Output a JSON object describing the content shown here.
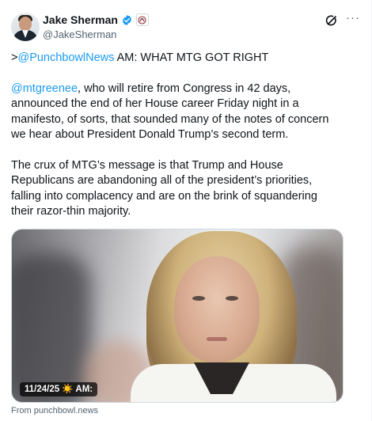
{
  "author": {
    "display_name": "Jake Sherman",
    "handle": "@JakeSherman",
    "verified_icon": "verified-badge-icon",
    "affiliation_icon": "affiliation-icon"
  },
  "actions": {
    "grok_icon": "grok-icon",
    "more_label": "···"
  },
  "tweet": {
    "line1_prefix": ">",
    "line1_link": "@PunchbowlNews",
    "line1_suffix": " AM: WHAT MTG GOT RIGHT",
    "p2_link": "@mtgreenee",
    "p2_text": ", who will retire from Congress in 42 days, announced the end of her House career Friday night in a manifesto, of sorts, that sounded many of the notes of concern we hear about President Donald Trump’s second term.",
    "p3_text": "The crux of MTG’s message is that Trump and House Republicans are abandoning all of the president’s priorities, falling into complacency and are on the brink of squandering their razor-thin majority."
  },
  "media": {
    "badge_text": "11/24/25 ☀️ AM:",
    "source_text": "From punchbowl.news"
  },
  "colors": {
    "link": "#1d9bf0",
    "verified": "#1d9bf0",
    "secondary_text": "#536471"
  }
}
